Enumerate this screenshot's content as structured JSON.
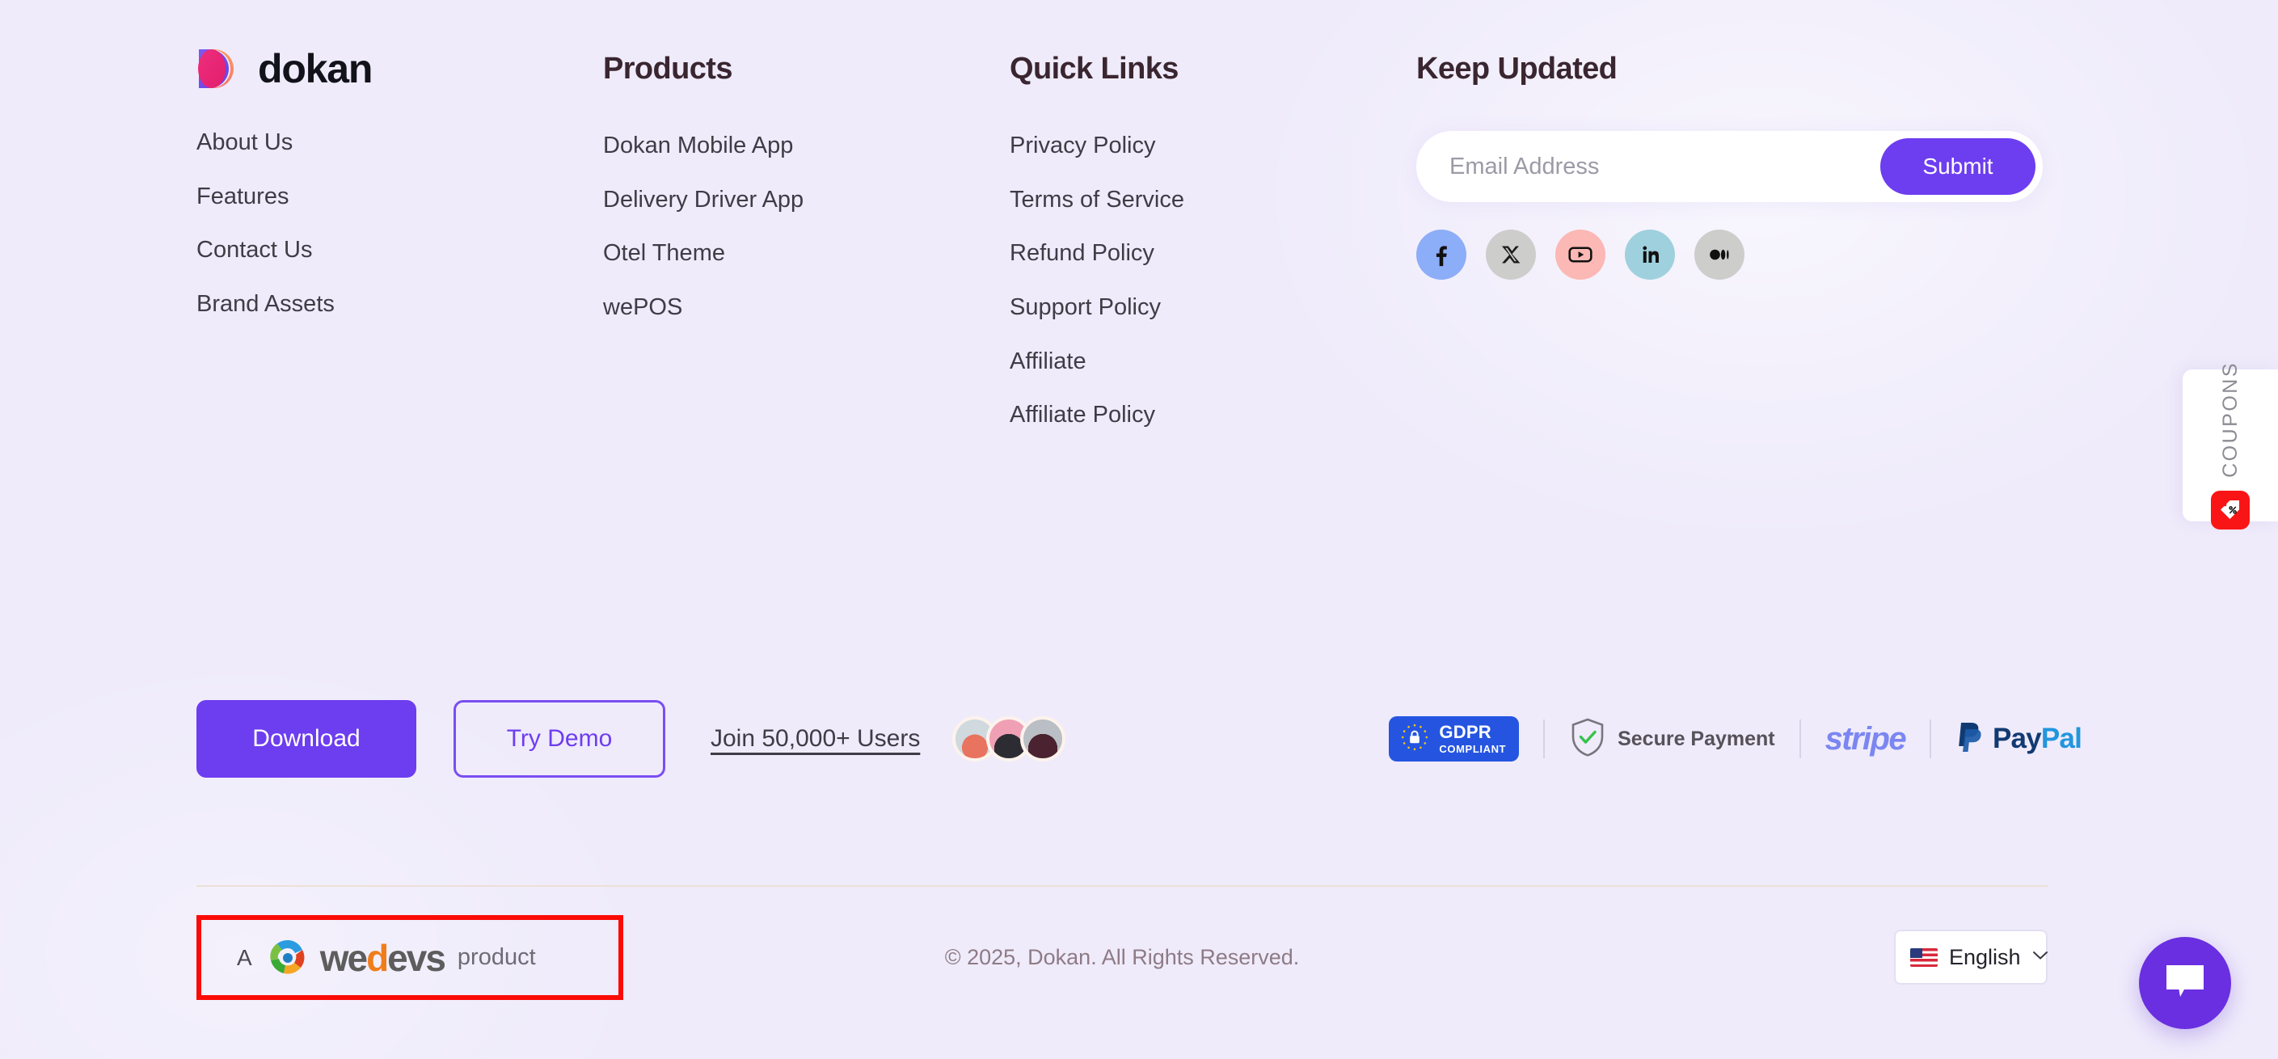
{
  "brand": {
    "logo_text": "dokan",
    "logo_icon": "dokan-d-mark-icon"
  },
  "columns": {
    "brand_links": [
      {
        "label": "About Us"
      },
      {
        "label": "Features"
      },
      {
        "label": "Contact Us"
      },
      {
        "label": "Brand Assets"
      }
    ],
    "products": {
      "heading": "Products",
      "links": [
        {
          "label": "Dokan Mobile App"
        },
        {
          "label": "Delivery Driver App"
        },
        {
          "label": "Otel Theme"
        },
        {
          "label": "wePOS"
        }
      ]
    },
    "quick_links": {
      "heading": "Quick Links",
      "links": [
        {
          "label": "Privacy Policy"
        },
        {
          "label": "Terms of Service"
        },
        {
          "label": "Refund Policy"
        },
        {
          "label": "Support Policy"
        },
        {
          "label": "Affiliate"
        },
        {
          "label": "Affiliate Policy"
        }
      ]
    },
    "keep_updated": {
      "heading": "Keep Updated",
      "email_placeholder": "Email Address",
      "email_value": "",
      "submit_label": "Submit",
      "socials": [
        {
          "name": "facebook-icon",
          "label": "Facebook",
          "bg": "#8cadf7"
        },
        {
          "name": "x-twitter-icon",
          "label": "X",
          "bg": "#cdcdcb"
        },
        {
          "name": "youtube-icon",
          "label": "YouTube",
          "bg": "#fbb8b4"
        },
        {
          "name": "linkedin-icon",
          "label": "LinkedIn",
          "bg": "#9fd0de"
        },
        {
          "name": "medium-icon",
          "label": "Medium",
          "bg": "#cdcdcb"
        }
      ]
    }
  },
  "cta": {
    "download_label": "Download",
    "demo_label": "Try Demo",
    "join_label": "Join 50,000+ Users",
    "avatar_count": 3
  },
  "trust": {
    "gdpr_line1": "GDPR",
    "gdpr_line2": "COMPLIANT",
    "secure_label": "Secure Payment",
    "stripe_label": "stripe",
    "paypal_label_a": "Pay",
    "paypal_label_b": "Pal"
  },
  "bottom": {
    "wedevs_prefix": "A",
    "wedevs_word_a": "we",
    "wedevs_word_b": "d",
    "wedevs_word_c": "evs",
    "wedevs_suffix": "product",
    "copyright": "© 2025, Dokan. All Rights Reserved.",
    "language": "English",
    "language_flag": "us-flag-icon"
  },
  "widgets": {
    "coupons_label": "COUPONS",
    "coupons_icon": "price-tag-percent-icon",
    "chat_icon": "chat-bubble-icon"
  },
  "colors": {
    "background": "#efebfb",
    "accent_purple": "#6d3df0",
    "heading": "#3a2630",
    "body_text": "#3f3c46",
    "muted": "#8e7b85",
    "highlight_box": "#fb0b06",
    "divider": "#ece0d6"
  }
}
